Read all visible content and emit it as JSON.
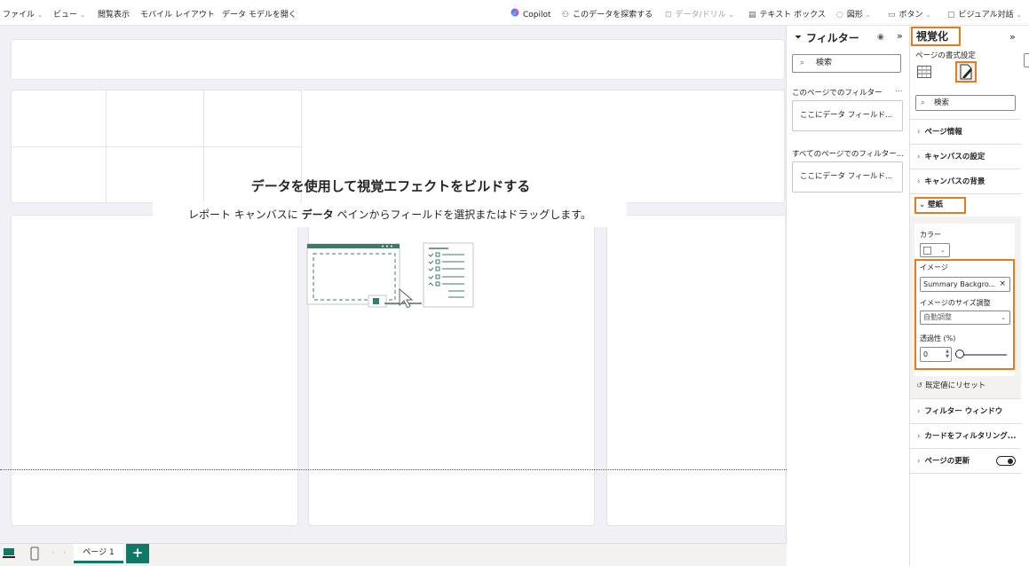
{
  "ribbon": {
    "file": "ファイル",
    "view": "ビュー",
    "reading_view": "閲覧表示",
    "mobile_layout": "モバイル レイアウト",
    "open_data_model": "データ モデルを開く",
    "copilot": "Copilot",
    "explore_data": "このデータを探索する",
    "data_drill": "データ/ドリル",
    "text_box": "テキスト ボックス",
    "shapes": "図形",
    "buttons": "ボタン",
    "visual_qa": "ビジュアル対話"
  },
  "canvas": {
    "build_title": "データを使用して視覚エフェクトをビルドする",
    "build_desc_prefix": "レポート キャンバスに ",
    "build_desc_bold": "データ",
    "build_desc_suffix": " ペインからフィールドを選択またはドラッグします。"
  },
  "filters": {
    "title": "フィルター",
    "search_placeholder": "検索",
    "this_page_label": "このページでのフィルター",
    "this_page_more": "...",
    "this_page_drop": "ここにデータ フィールド...",
    "all_pages_label": "すべてのページでのフィルター...",
    "all_pages_drop": "ここにデータ フィールド..."
  },
  "viz": {
    "title": "視覚化",
    "page_format": "ページの書式設定",
    "search_placeholder": "検索",
    "sections": {
      "page_info": "ページ情報",
      "canvas_settings": "キャンバスの設定",
      "canvas_background": "キャンバスの背景",
      "wallpaper": "壁紙",
      "filter_pane": "フィルター ウィンドウ",
      "filter_cards": "カードをフィルタリング...",
      "page_refresh": "ページの更新"
    },
    "wallpaper": {
      "color_label": "カラー",
      "image_label": "イメージ",
      "image_value": "Summary Backgro...",
      "image_fit_label": "イメージのサイズ調整",
      "image_fit_value": "自動調整",
      "transparency_label": "透過性 (%)",
      "transparency_value": "0",
      "transparency_percent": 0,
      "reset_label": "既定値にリセット"
    },
    "page_refresh_on": false
  },
  "bottom": {
    "page_tab": "ページ 1",
    "add_page": "+"
  },
  "colors": {
    "accent": "#117865",
    "highlight": "#e87a1e"
  }
}
